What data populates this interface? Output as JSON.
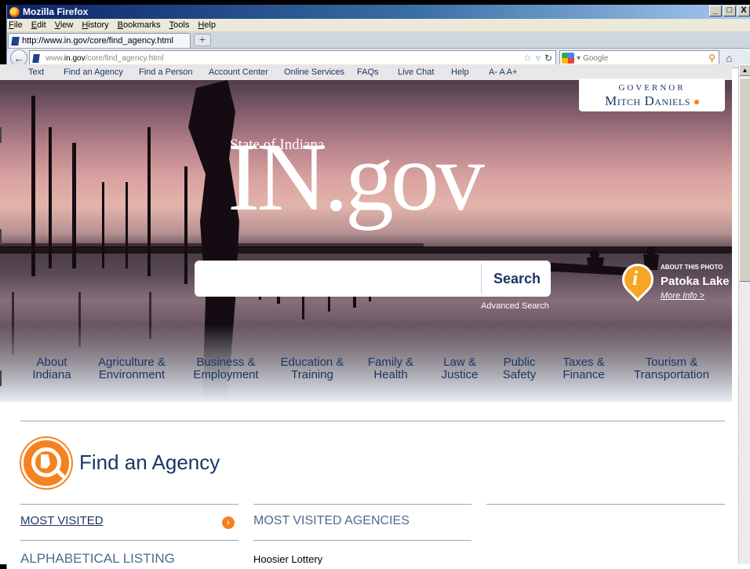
{
  "browser": {
    "title": "Mozilla Firefox",
    "window_buttons": [
      "_",
      "□",
      "X"
    ],
    "menu": [
      "File",
      "Edit",
      "View",
      "History",
      "Bookmarks",
      "Tools",
      "Help"
    ],
    "tab_title": "http://www.in.gov/core/find_agency.html",
    "new_tab_label": "+",
    "url_prefix": "www.",
    "url_host": "in.gov",
    "url_path": "/core/find_agency.html",
    "search_placeholder": "Google"
  },
  "page": {
    "utility_nav": [
      "Text",
      "Find an Agency",
      "Find a Person",
      "Account Center",
      "Online Services",
      "FAQs",
      "Live Chat",
      "Help",
      "A- A A+"
    ],
    "governor": {
      "label": "GOVERNOR",
      "name": "Mitch Daniels"
    },
    "logo": {
      "small": "State of Indiana",
      "big": "IN.gov"
    },
    "search": {
      "value": "",
      "button": "Search",
      "advanced": "Advanced Search"
    },
    "photo": {
      "about": "ABOUT THIS PHOTO",
      "name": "Patoka Lake",
      "more": "More Info >"
    },
    "categories": [
      [
        "About",
        "Indiana"
      ],
      [
        "Agriculture &",
        "Environment"
      ],
      [
        "Business &",
        "Employment"
      ],
      [
        "Education &",
        "Training"
      ],
      [
        "Family &",
        "Health"
      ],
      [
        "Law &",
        "Justice"
      ],
      [
        "Public",
        "Safety"
      ],
      [
        "Taxes &",
        "Finance"
      ],
      [
        "Tourism &",
        "Transportation"
      ]
    ],
    "find_agency": {
      "title": "Find an Agency",
      "most_visited": "MOST VISITED",
      "alphabetical": "ALPHABETICAL LISTING",
      "column_heading": "MOST VISITED AGENCIES",
      "agencies": [
        "Hoosier Lottery"
      ]
    }
  },
  "colors": {
    "accent_orange": "#f5821f",
    "navy": "#1b3764"
  }
}
